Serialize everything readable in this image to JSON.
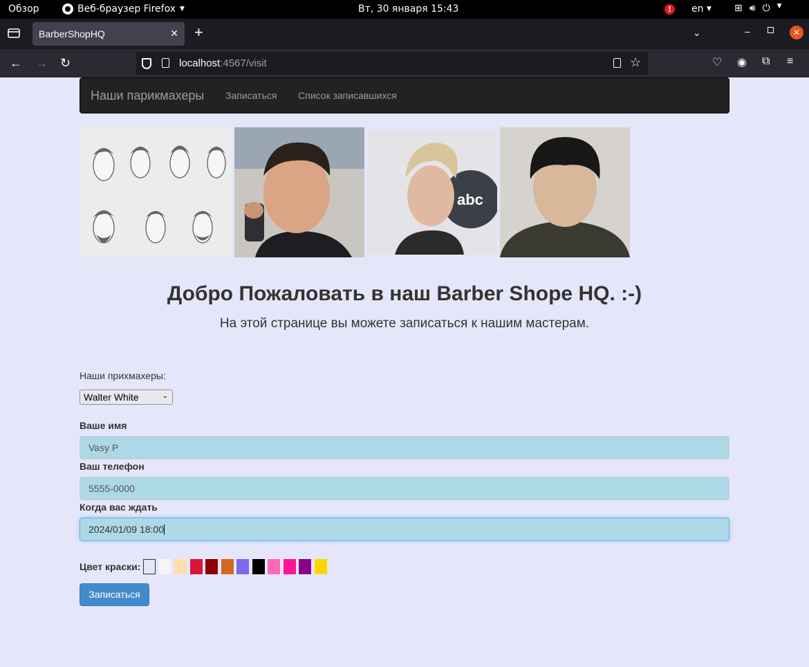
{
  "system_bar": {
    "overview": "Обзор",
    "app_name": "Веб-браузер Firefox",
    "clock": "Вт, 30 января  15:43",
    "lang": "en"
  },
  "browser": {
    "tab_title": "BarberShopHQ",
    "url_host": "localhost",
    "url_rest": ":4567/visit"
  },
  "site_nav": {
    "brand": "Наши парикмахеры",
    "links": [
      "Записаться",
      "Список записавшихся"
    ]
  },
  "hero": {
    "title": "Добро Пожаловать в наш Barber Shope HQ. :-)",
    "subtitle": "На этой странице вы можете записаться к нашим мастерам."
  },
  "form": {
    "barbers_label": "Наши прихмахеры:",
    "barber_selected": "Walter White",
    "name_label": "Ваше имя",
    "name_value": "Vasy P",
    "phone_label": "Ваш телефон",
    "phone_value": "5555-0000",
    "date_label": "Когда вас ждать",
    "date_value": "2024/01/09 18:00",
    "color_label": "Цвет краски:",
    "colors": [
      "#e6e6fa",
      "#f5f5f5",
      "#ffdead",
      "#dc143c",
      "#8b0000",
      "#d2691e",
      "#7b68ee",
      "#000000",
      "#ff69b4",
      "#ff1493",
      "#8b008b",
      "#ffd700"
    ],
    "selected_color_index": 0,
    "submit_label": "Записаться"
  },
  "colors": {
    "page_bg": "#e6e6fa",
    "input_bg": "#add8e6",
    "button": "#428bca",
    "navbar": "#222222"
  }
}
